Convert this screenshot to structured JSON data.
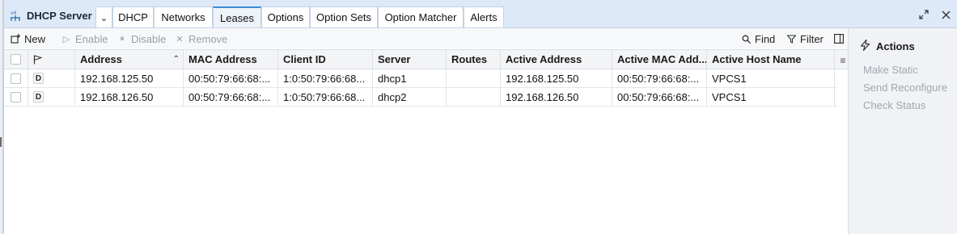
{
  "app": {
    "title": "DHCP Server"
  },
  "tabs": [
    {
      "label": "DHCP"
    },
    {
      "label": "Networks"
    },
    {
      "label": "Leases"
    },
    {
      "label": "Options"
    },
    {
      "label": "Option Sets"
    },
    {
      "label": "Option Matcher"
    },
    {
      "label": "Alerts"
    }
  ],
  "toolbar": {
    "new_label": "New",
    "enable_label": "Enable",
    "disable_label": "Disable",
    "remove_label": "Remove",
    "find_label": "Find",
    "filter_label": "Filter"
  },
  "table": {
    "columns": [
      "Address",
      "MAC Address",
      "Client ID",
      "Server",
      "Routes",
      "Active Address",
      "Active MAC Add...",
      "Active Host Name"
    ],
    "rows": [
      {
        "flag": "D",
        "address": "192.168.125.50",
        "mac": "00:50:79:66:68:...",
        "client_id": "1:0:50:79:66:68...",
        "server": "dhcp1",
        "routes": "",
        "active_address": "192.168.125.50",
        "active_mac": "00:50:79:66:68:...",
        "active_host": "VPCS1"
      },
      {
        "flag": "D",
        "address": "192.168.126.50",
        "mac": "00:50:79:66:68:...",
        "client_id": "1:0:50:79:66:68...",
        "server": "dhcp2",
        "routes": "",
        "active_address": "192.168.126.50",
        "active_mac": "00:50:79:66:68:...",
        "active_host": "VPCS1"
      }
    ]
  },
  "actions": {
    "title": "Actions",
    "items": [
      "Make Static",
      "Send Reconfigure",
      "Check Status"
    ]
  },
  "colors": {
    "accent": "#3d8ad9",
    "titlebar": "#dde9f8",
    "disabled": "#9aa0a6"
  }
}
